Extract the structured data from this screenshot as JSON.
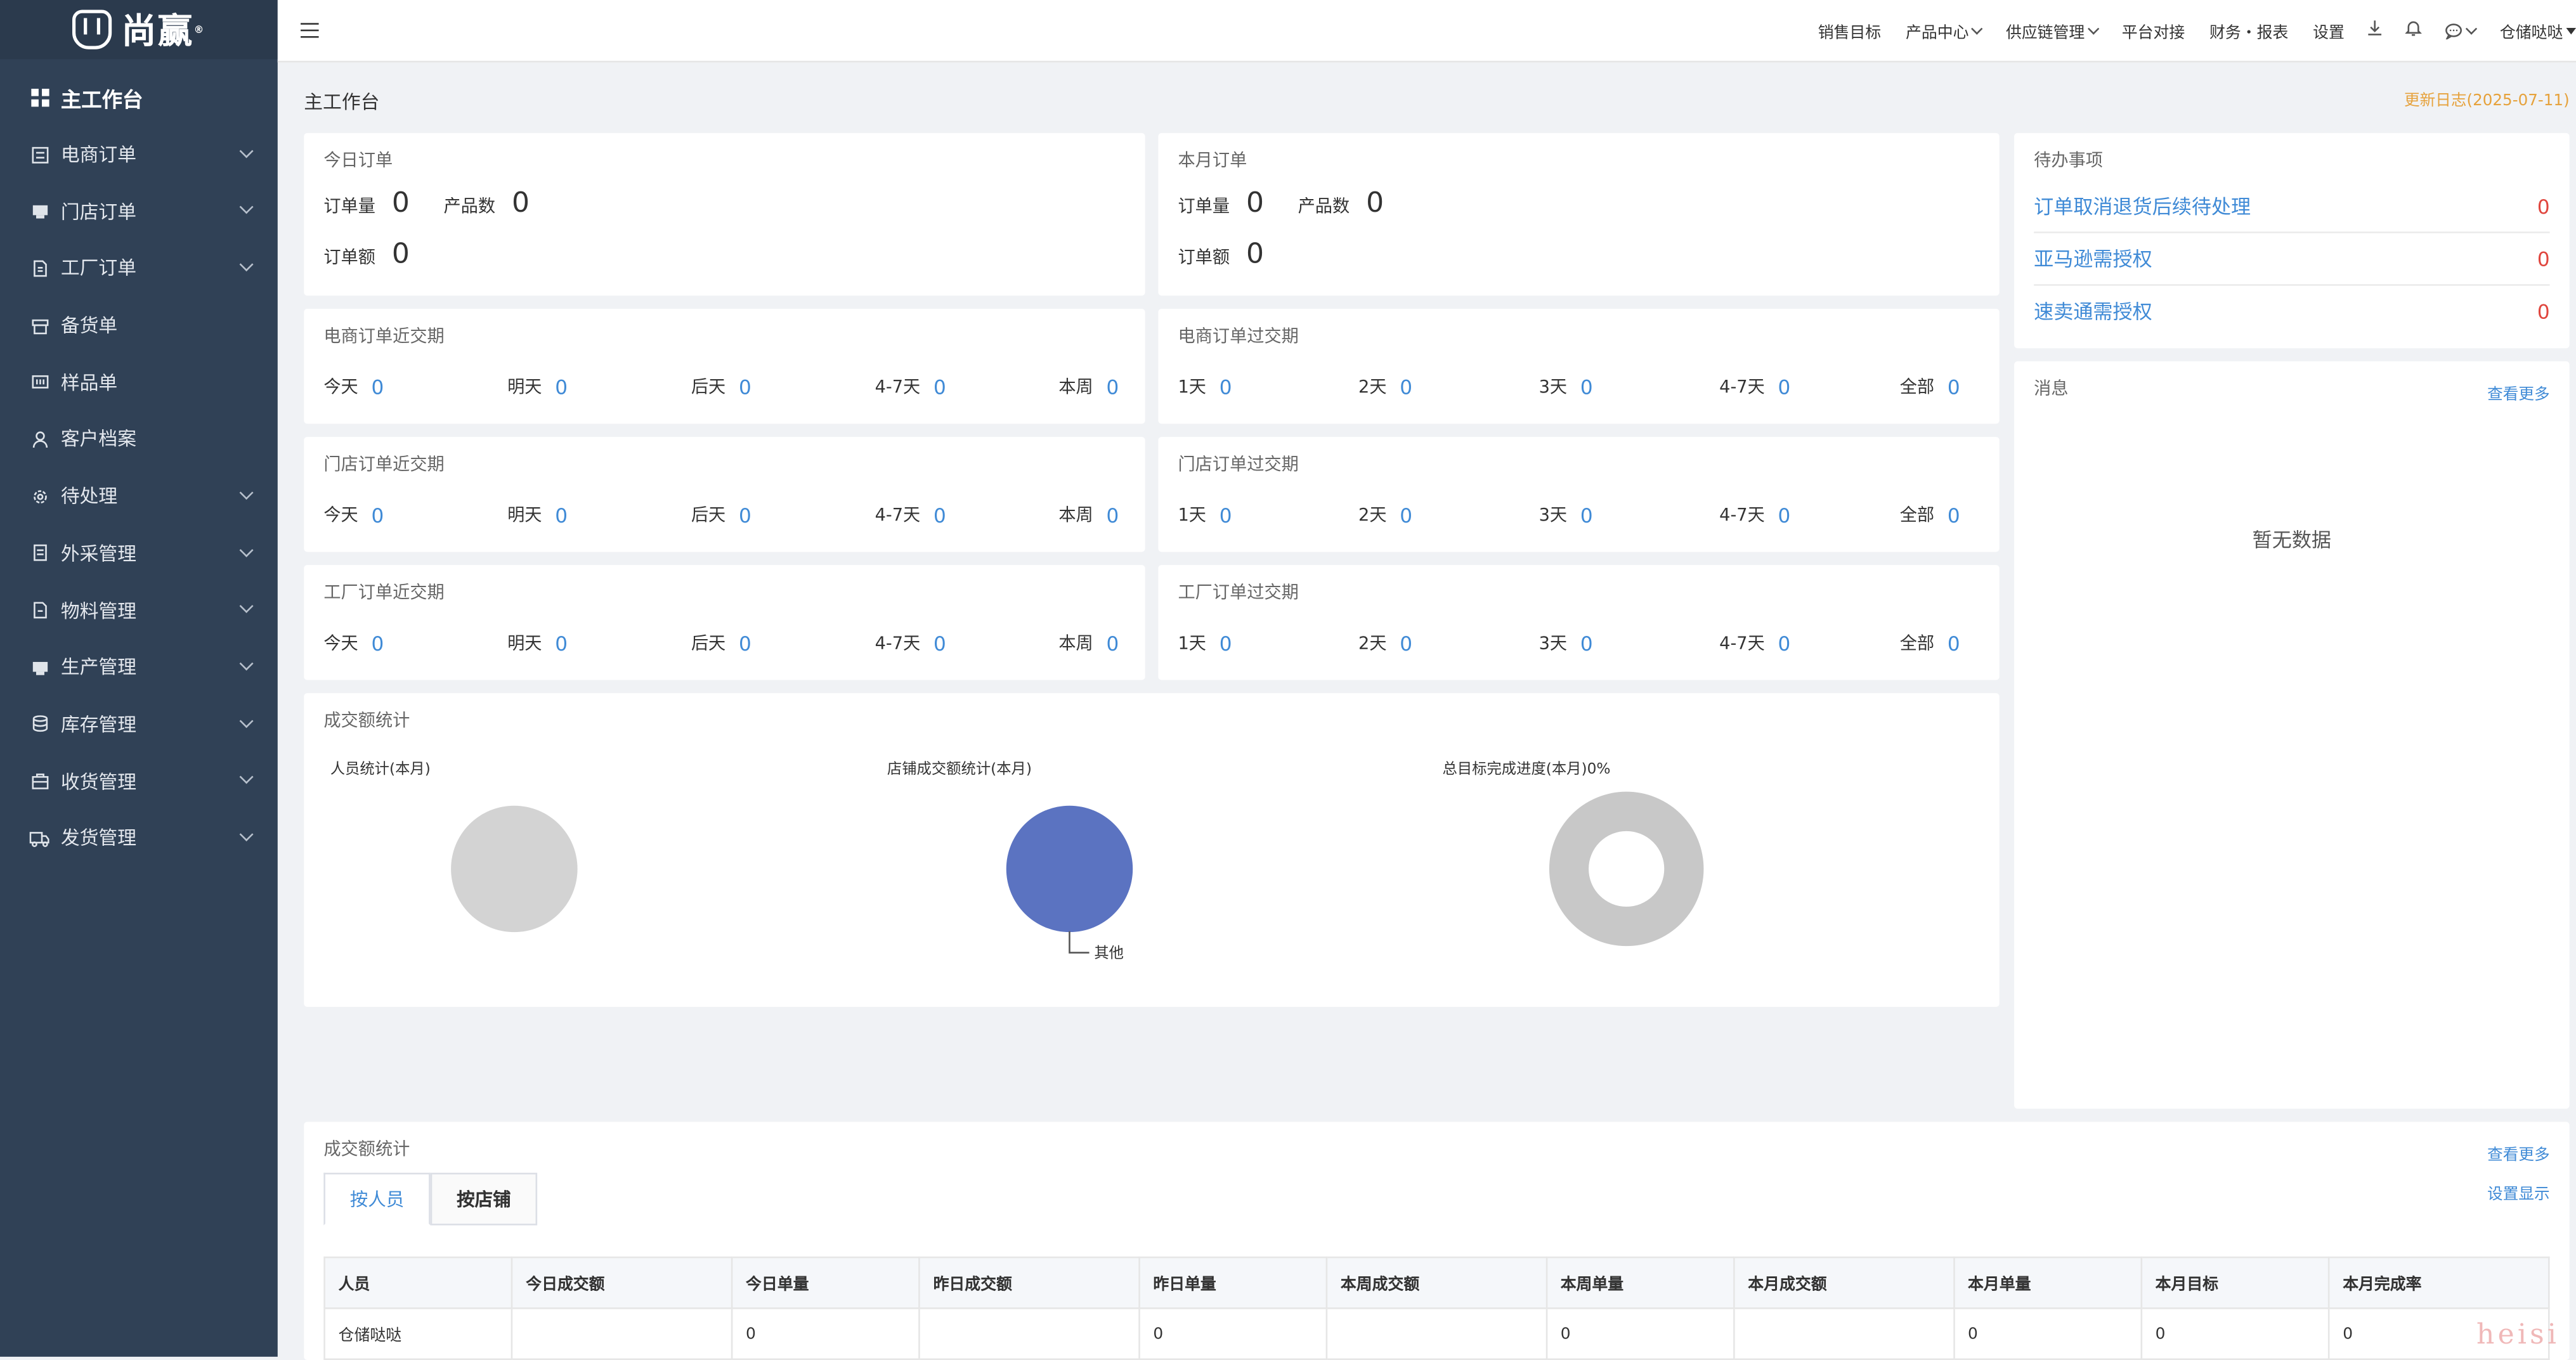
{
  "brand": {
    "name": "尚赢",
    "reg": "®"
  },
  "sidebar": {
    "items": [
      {
        "label": "主工作台",
        "icon": "grid-icon"
      },
      {
        "label": "电商订单",
        "icon": "document-icon"
      },
      {
        "label": "门店订单",
        "icon": "store-icon"
      },
      {
        "label": "工厂订单",
        "icon": "file-icon"
      },
      {
        "label": "备货单",
        "icon": "box-icon"
      },
      {
        "label": "样品单",
        "icon": "barcode-icon"
      },
      {
        "label": "客户档案",
        "icon": "user-icon"
      },
      {
        "label": "待处理",
        "icon": "gear-icon"
      },
      {
        "label": "外采管理",
        "icon": "list-icon"
      },
      {
        "label": "物料管理",
        "icon": "file-icon"
      },
      {
        "label": "生产管理",
        "icon": "store-icon"
      },
      {
        "label": "库存管理",
        "icon": "database-icon"
      },
      {
        "label": "收货管理",
        "icon": "package-icon"
      },
      {
        "label": "发货管理",
        "icon": "truck-icon"
      }
    ]
  },
  "header": {
    "nav": [
      "销售目标",
      "产品中心",
      "供应链管理",
      "平台对接",
      "财务・报表",
      "设置"
    ],
    "user": "仓储哒哒"
  },
  "main": {
    "title": "主工作台",
    "update_log": "更新日志(2025-07-11)",
    "today": {
      "title": "今日订单",
      "order_count_label": "订单量",
      "order_count": "0",
      "product_count_label": "产品数",
      "product_count": "0",
      "order_amount_label": "订单额",
      "order_amount": "0"
    },
    "month": {
      "title": "本月订单",
      "order_count_label": "订单量",
      "order_count": "0",
      "product_count_label": "产品数",
      "product_count": "0",
      "order_amount_label": "订单额",
      "order_amount": "0"
    },
    "ecom_near": {
      "title": "电商订单近交期",
      "items": [
        {
          "k": "今天",
          "v": "0"
        },
        {
          "k": "明天",
          "v": "0"
        },
        {
          "k": "后天",
          "v": "0"
        },
        {
          "k": "4-7天",
          "v": "0"
        },
        {
          "k": "本周",
          "v": "0"
        }
      ]
    },
    "ecom_over": {
      "title": "电商订单过交期",
      "items": [
        {
          "k": "1天",
          "v": "0"
        },
        {
          "k": "2天",
          "v": "0"
        },
        {
          "k": "3天",
          "v": "0"
        },
        {
          "k": "4-7天",
          "v": "0"
        },
        {
          "k": "全部",
          "v": "0"
        }
      ]
    },
    "store_near": {
      "title": "门店订单近交期",
      "items": [
        {
          "k": "今天",
          "v": "0"
        },
        {
          "k": "明天",
          "v": "0"
        },
        {
          "k": "后天",
          "v": "0"
        },
        {
          "k": "4-7天",
          "v": "0"
        },
        {
          "k": "本周",
          "v": "0"
        }
      ]
    },
    "store_over": {
      "title": "门店订单过交期",
      "items": [
        {
          "k": "1天",
          "v": "0"
        },
        {
          "k": "2天",
          "v": "0"
        },
        {
          "k": "3天",
          "v": "0"
        },
        {
          "k": "4-7天",
          "v": "0"
        },
        {
          "k": "全部",
          "v": "0"
        }
      ]
    },
    "factory_near": {
      "title": "工厂订单近交期",
      "items": [
        {
          "k": "今天",
          "v": "0"
        },
        {
          "k": "明天",
          "v": "0"
        },
        {
          "k": "后天",
          "v": "0"
        },
        {
          "k": "4-7天",
          "v": "0"
        },
        {
          "k": "本周",
          "v": "0"
        }
      ]
    },
    "factory_over": {
      "title": "工厂订单过交期",
      "items": [
        {
          "k": "1天",
          "v": "0"
        },
        {
          "k": "2天",
          "v": "0"
        },
        {
          "k": "3天",
          "v": "0"
        },
        {
          "k": "4-7天",
          "v": "0"
        },
        {
          "k": "全部",
          "v": "0"
        }
      ]
    },
    "todo": {
      "title": "待办事项",
      "items": [
        {
          "label": "订单取消退货后续待处理",
          "count": "0"
        },
        {
          "label": "亚马逊需授权",
          "count": "0"
        },
        {
          "label": "速卖通需授权",
          "count": "0"
        }
      ]
    },
    "messages": {
      "title": "消息",
      "more": "查看更多",
      "empty": "暂无数据"
    },
    "stats": {
      "title": "成交额统计"
    },
    "table_section": {
      "title": "成交额统计",
      "more": "查看更多",
      "settings": "设置显示",
      "tabs": [
        "按人员",
        "按店铺"
      ],
      "columns": [
        "人员",
        "今日成交额",
        "今日单量",
        "昨日成交额",
        "昨日单量",
        "本周成交额",
        "本周单量",
        "本月成交额",
        "本月单量",
        "本月目标",
        "本月完成率"
      ],
      "rows": [
        [
          "仓储哒哒",
          "",
          "0",
          "",
          "0",
          "",
          "0",
          "",
          "0",
          "0",
          "0"
        ]
      ]
    },
    "watermark": "heisi"
  },
  "chart_data": [
    {
      "type": "pie",
      "title": "人员统计(本月)",
      "categories": [],
      "values": [],
      "colors": [
        "#d3d3d3"
      ]
    },
    {
      "type": "pie",
      "title": "店铺成交额统计(本月)",
      "categories": [
        "其他"
      ],
      "values": [
        100
      ],
      "colors": [
        "#5b73c1"
      ]
    },
    {
      "type": "pie",
      "title": "总目标完成进度(本月)0%",
      "categories": [],
      "values": [
        0
      ],
      "donut": true,
      "colors": [
        "#c8c8c8"
      ]
    }
  ]
}
